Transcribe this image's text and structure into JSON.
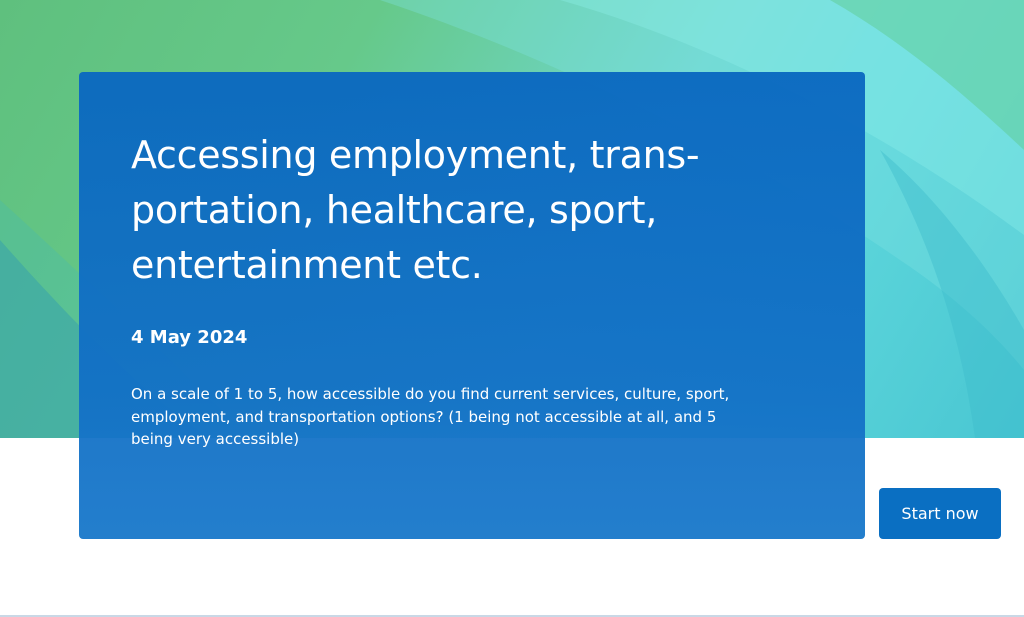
{
  "survey": {
    "title": "Accessing employment, trans-portation, healthcare, sport, entertainment etc.",
    "date": "4 May 2024",
    "description": "On a scale of 1 to 5, how accessible do you find current services, culture, sport, employment, and transportation options? (1 being not accessible at all, and 5 being very accessible)",
    "start_label": "Start now"
  },
  "colors": {
    "card_blue": "#0a68c0",
    "button_blue": "#0a6fc2",
    "hero_green": "#5fc07e",
    "hero_cyan": "#49c6d2"
  }
}
